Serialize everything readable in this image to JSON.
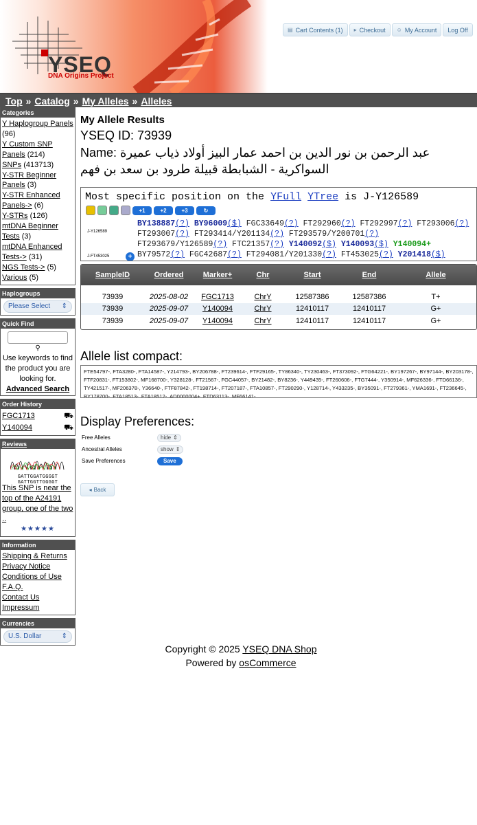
{
  "header": {
    "logo_text": "YSEQ",
    "logo_subtitle": "DNA Origins Project",
    "cart_label": "Cart Contents (1)",
    "checkout_label": "Checkout",
    "account_label": "My Account",
    "logoff_label": "Log Off"
  },
  "breadcrumb": {
    "top": "Top",
    "catalog": "Catalog",
    "my_alleles": "My Alleles",
    "alleles": "Alleles",
    "separator": "»"
  },
  "sidebar": {
    "categories_title": "Categories",
    "categories": [
      {
        "label": "Y Haplogroup Panels",
        "count": "(96)"
      },
      {
        "label": "Y Custom SNP Panels",
        "count": "(214)"
      },
      {
        "label": "SNPs",
        "count": "(413713)"
      },
      {
        "label": "Y-STR Beginner Panels",
        "count": "(3)"
      },
      {
        "label": "Y-STR Enhanced Panels->",
        "count": "(6)"
      },
      {
        "label": "Y-STRs",
        "count": "(126)"
      },
      {
        "label": "mtDNA Beginner Tests",
        "count": "(3)"
      },
      {
        "label": "mtDNA Enhanced Tests->",
        "count": "(31)"
      },
      {
        "label": "NGS Tests->",
        "count": "(5)"
      },
      {
        "label": "Various",
        "count": "(5)"
      }
    ],
    "haplogroups_title": "Haplogroups",
    "haplogroups_select": "Please Select",
    "quickfind_title": "Quick Find",
    "quickfind_hint": "Use keywords to find the product you are looking for.",
    "advanced_search": "Advanced Search",
    "order_history_title": "Order History",
    "order_history": [
      "FGC1713",
      "Y140094"
    ],
    "reviews_title": "Reviews",
    "review_text": "This SNP is near the top of the A24191 group, one of the two ..",
    "review_stars": "★★★★★",
    "chromatogram_top": "GATTGGATGGGGT",
    "chromatogram_bottom": "GATTGGTTGGGGT",
    "information_title": "Information",
    "information_links": [
      "Shipping & Returns",
      "Privacy Notice",
      "Conditions of Use",
      "F.A.Q.",
      "Contact Us",
      "Impressum"
    ],
    "currencies_title": "Currencies",
    "currency_select": "U.S. Dollar"
  },
  "main": {
    "title": "My Allele Results",
    "yseq_id": "YSEQ ID: 73939",
    "name_label": "Name:",
    "name_value": "عبد الرحمن بن نور الدين بن احمد عمار البيز أولاد ذياب عميرة السواكرية - الشبابطة قبيلة طرود بن سعد بن فهم",
    "tree": {
      "prefix": "Most specific position on the",
      "link1": "YFull",
      "link2": "YTree",
      "suffix": "is J-Y126589",
      "zoom_buttons": [
        "+1",
        "+2",
        "+3",
        "↻"
      ],
      "node1": "J-Y126589",
      "node2": "J-FT453025",
      "line1": [
        {
          "t": "BY138887",
          "c": "b"
        },
        {
          "t": "(?)",
          "c": "q"
        },
        {
          "t": " "
        },
        {
          "t": "BY96009",
          "c": "b"
        },
        {
          "t": "($)",
          "c": "q"
        },
        {
          "t": " FGC33649"
        },
        {
          "t": "(?)",
          "c": "q"
        },
        {
          "t": " FT292960"
        },
        {
          "t": "(?)",
          "c": "q"
        },
        {
          "t": " FT292997"
        },
        {
          "t": "(?)",
          "c": "q"
        },
        {
          "t": " FT293006"
        },
        {
          "t": "(?)",
          "c": "q"
        }
      ],
      "line2": [
        {
          "t": "FT293007"
        },
        {
          "t": "(?)",
          "c": "q"
        },
        {
          "t": " FT293414/Y201134"
        },
        {
          "t": "(?)",
          "c": "q"
        },
        {
          "t": " FT293579/Y200701"
        },
        {
          "t": "(?)",
          "c": "q"
        }
      ],
      "line3": [
        {
          "t": "FT293679/Y126589"
        },
        {
          "t": "(?)",
          "c": "q"
        },
        {
          "t": " FTC21357"
        },
        {
          "t": "(?)",
          "c": "q"
        },
        {
          "t": " "
        },
        {
          "t": "Y140092",
          "c": "b"
        },
        {
          "t": "($)",
          "c": "q"
        },
        {
          "t": " "
        },
        {
          "t": "Y140093",
          "c": "b"
        },
        {
          "t": "($)",
          "c": "q"
        },
        {
          "t": " "
        },
        {
          "t": "Y140094+",
          "c": "g"
        }
      ],
      "line4": [
        {
          "t": "BY79572"
        },
        {
          "t": "(?)",
          "c": "q"
        },
        {
          "t": " FGC42687"
        },
        {
          "t": "(?)",
          "c": "q"
        },
        {
          "t": " FT294081/Y201330"
        },
        {
          "t": "(?)",
          "c": "q"
        },
        {
          "t": " FT453025"
        },
        {
          "t": "(?)",
          "c": "q"
        },
        {
          "t": " "
        },
        {
          "t": "Y201418",
          "c": "b"
        },
        {
          "t": "($)",
          "c": "q"
        }
      ],
      "line5": [
        {
          "t": "Y327507/FTC32095"
        },
        {
          "t": "(?)",
          "c": "q"
        }
      ]
    },
    "table": {
      "headers": [
        "SampleID",
        "Ordered",
        "Marker+",
        "Chr",
        "Start",
        "End",
        "Allele"
      ],
      "rows": [
        [
          "73939",
          "2025-08-02",
          "FGC1713",
          "ChrY",
          "12587386",
          "12587386",
          "T+"
        ],
        [
          "73939",
          "2025-09-07",
          "Y140094",
          "ChrY",
          "12410117",
          "12410117",
          "G+"
        ],
        [
          "73939",
          "2025-09-07",
          "Y140094",
          "ChrY",
          "12410117",
          "12410117",
          "G+"
        ]
      ]
    },
    "compact_title": "Allele list compact:",
    "compact_text": "FTE54797-, FTA3280-, FTA14587-, Y214793-, BY206788-, FT239614-, FTF29165-, TY86340-, TY230463-, FT373092-, FTG64221-, BY197267-, BY97144-, BY203178-, FTF20831-, FT153802-, MF168700-, Y328128-, FT21567-, FGC44057-, BY21482-, BY8236-, Y449435-, FT260606-, FTG7444-, Y350914-, MF626336-, FTD66136-, TY421517-, MF206378-, Y36640-, FTF87842-, FT198714-, FT207187-, FTA10857-, FT290290-, Y128714-, Y433235-, BY35091-, FT279361-, YMA1691-, FT236645-, BY178700-, FTA18513-, FTA18512-, AD0000004+, FTD63113-, MF66141-,",
    "pref_title": "Display Preferences:",
    "pref_free_label": "Free Alleles",
    "pref_free_value": "hide",
    "pref_anc_label": "Ancestral Alleles",
    "pref_anc_value": "show",
    "pref_save_label": "Save Preferences",
    "save_button": "Save",
    "back_button": "Back"
  },
  "footer": {
    "copyright": "Copyright © 2025",
    "shop_link": "YSEQ DNA Shop",
    "powered": "Powered by",
    "powered_link": "osCommerce"
  },
  "colors": {
    "header_gray": "#505050",
    "link_blue": "#1a3cc0",
    "button_blue": "#1e6fd6",
    "positive_green": "#1a9a1a",
    "helix_red": "#e8401c"
  }
}
